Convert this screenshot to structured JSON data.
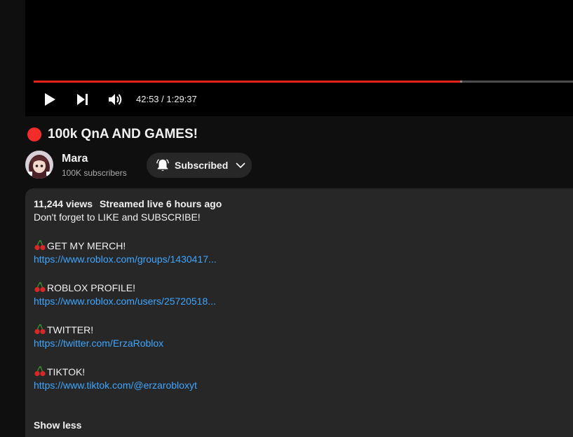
{
  "player": {
    "current_time": "42:53",
    "duration": "1:29:37",
    "time_text": "42:53 / 1:29:37",
    "progress_played_fraction": 0.79,
    "progress_buffered_fraction": 0.795,
    "colors": {
      "played": "#e62117",
      "buffered": "#8a8a8a",
      "track": "#4d4d4d"
    }
  },
  "video": {
    "title": "100k QnA AND GAMES!",
    "live_indicator_color": "#f22b2b"
  },
  "channel": {
    "name": "Mara",
    "subscribers": "100K subscribers",
    "subscribe_button_label": "Subscribed"
  },
  "description": {
    "views": "11,244 views",
    "streamed": "Streamed live 6 hours ago",
    "intro": "Don't forget to LIKE and SUBSCRIBE!",
    "sections": [
      {
        "heading": "GET MY MERCH!",
        "link": "https://www.roblox.com/groups/1430417..."
      },
      {
        "heading": "ROBLOX PROFILE!",
        "link": "https://www.roblox.com/users/25720518..."
      },
      {
        "heading": "TWITTER!",
        "link": "https://twitter.com/ErzaRoblox"
      },
      {
        "heading": "TIKTOK!",
        "link": "https://www.tiktok.com/@erzarobloxyt"
      }
    ],
    "show_less_label": "Show less",
    "link_color": "#3ea6ff"
  },
  "icons": {
    "play": "play-icon",
    "next": "next-icon",
    "volume": "volume-icon",
    "bell": "bell-icon",
    "chevron": "chevron-down-icon",
    "cherry": "cherry-emoji-icon"
  }
}
